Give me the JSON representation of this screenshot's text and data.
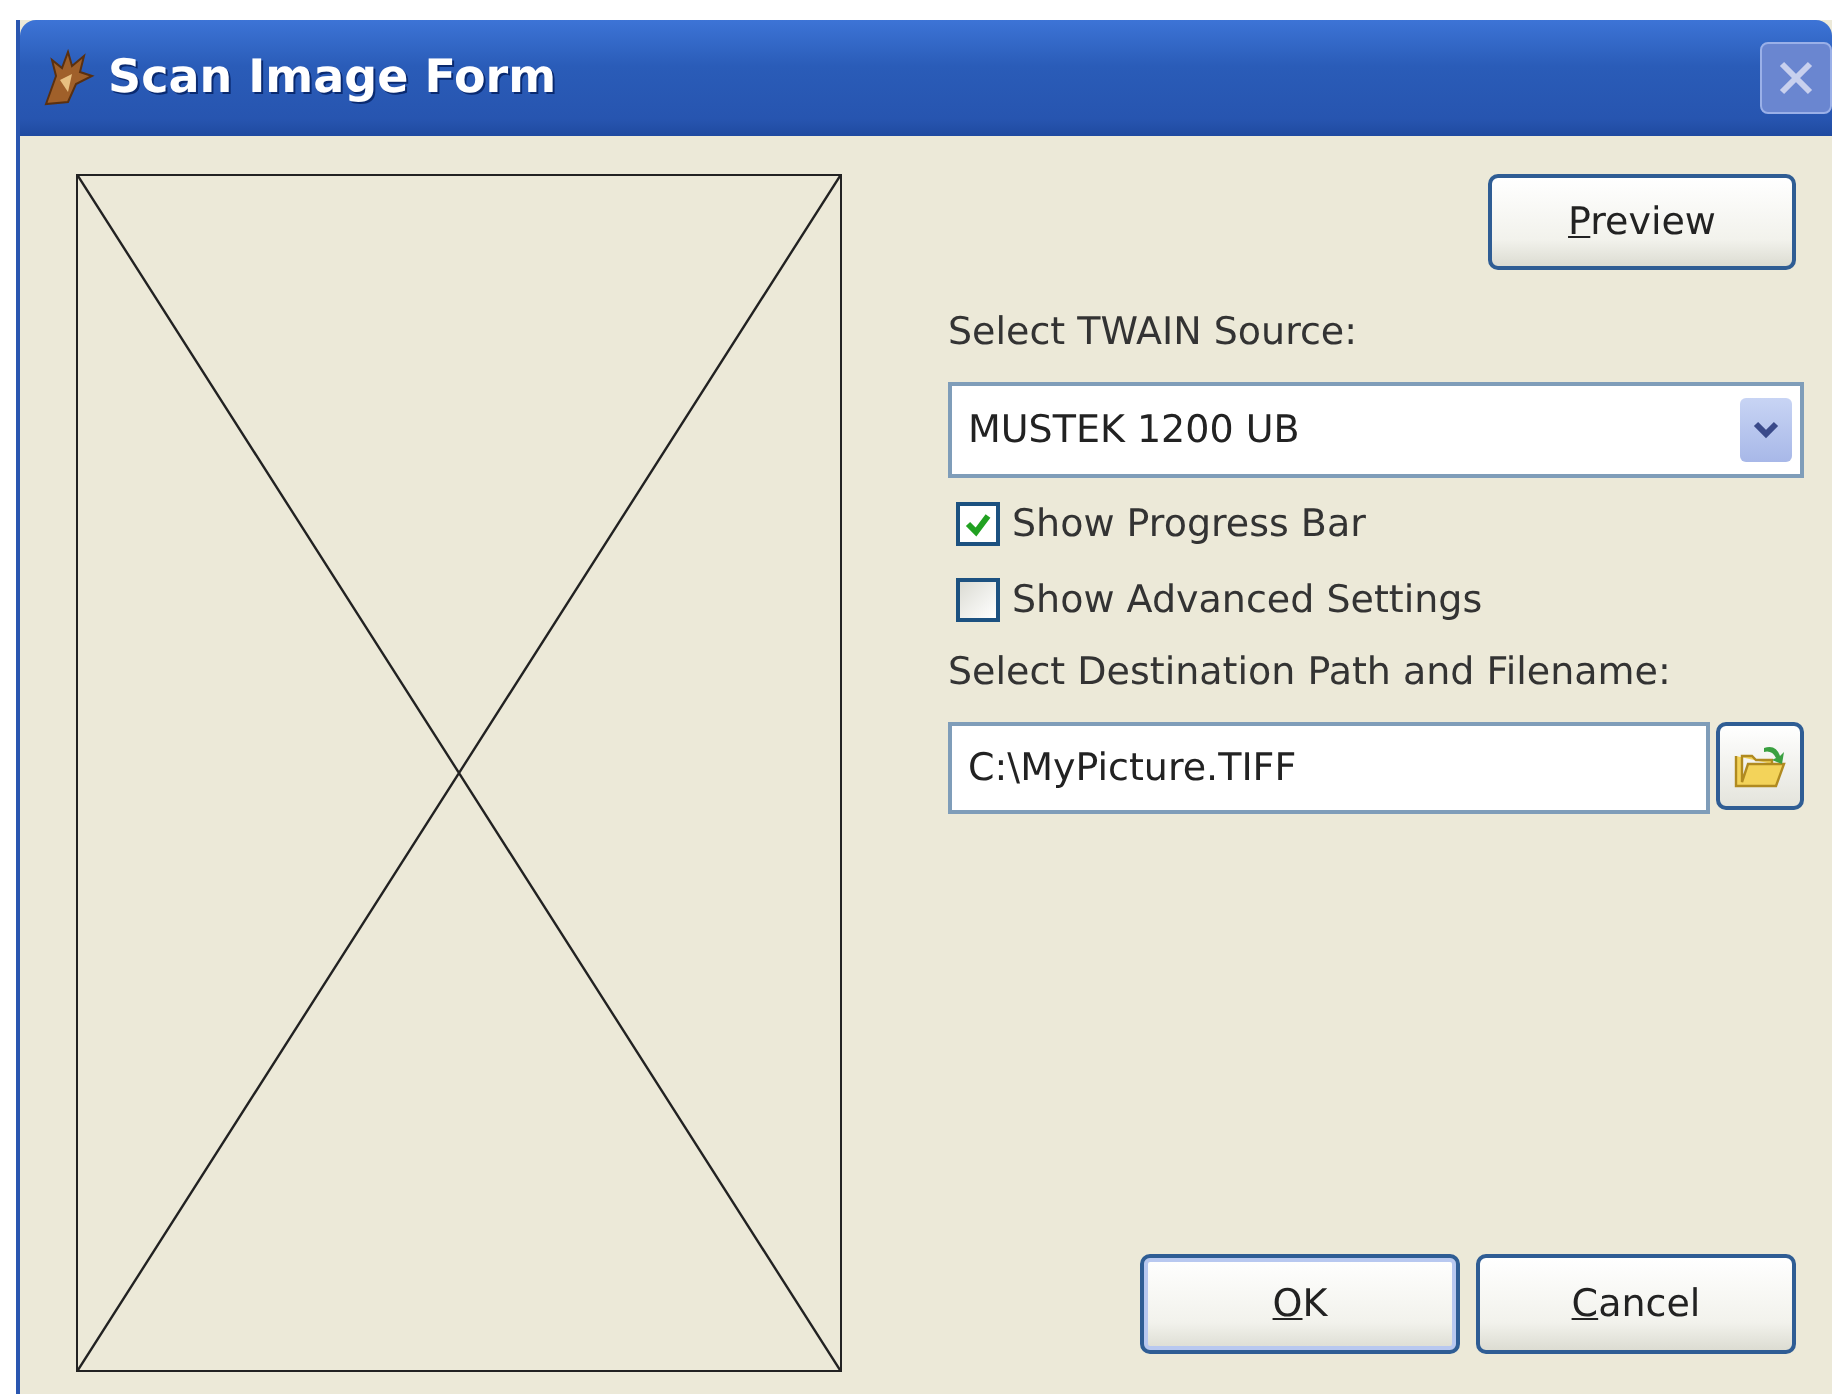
{
  "window": {
    "title": "Scan Image Form"
  },
  "preview_button": {
    "label": "Preview",
    "mnemonic": true
  },
  "source": {
    "label": "Select TWAIN Source:",
    "value": "MUSTEK 1200 UB"
  },
  "options": [
    {
      "label": "Show Progress Bar",
      "checked": true
    },
    {
      "label": "Show Advanced Settings",
      "checked": false
    }
  ],
  "destination": {
    "label": "Select Destination Path and Filename:",
    "value": "C:\\MyPicture.TIFF"
  },
  "buttons": [
    {
      "label": "OK",
      "mnemonic": true,
      "default": true
    },
    {
      "label": "Cancel",
      "mnemonic": true,
      "default": false
    }
  ]
}
